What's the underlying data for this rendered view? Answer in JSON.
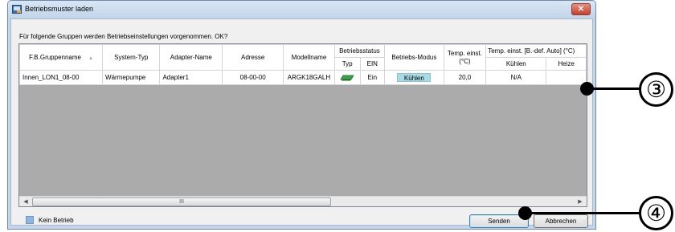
{
  "window": {
    "title": "Betriebsmuster laden",
    "close_glyph": "✕",
    "icon": "window-app-icon"
  },
  "prompt": "Für folgende Gruppen werden Betriebseinstellungen vorgenommen. OK?",
  "grid": {
    "headers": {
      "group_name": "F.B.Gruppenname",
      "system_type": "System-Typ",
      "adapter_name": "Adapter-Name",
      "address": "Adresse",
      "model_name": "Modellname",
      "operation_status": "Betriebsstatus",
      "op_type": "Typ",
      "op_on": "EIN",
      "mode": "Betriebs-Modus",
      "temp_set": "Temp. einst.",
      "temp_unit": "(°C)",
      "temp_auto": "Temp. einst. [B.-def. Auto] (°C)",
      "cooling": "Kühlen",
      "heating": "Heize"
    },
    "rows": [
      {
        "group_name": "Innen_LON1_08-00",
        "system_type": "Wärmepumpe",
        "adapter_name": "Adapter1",
        "address": "08-00-00",
        "model_name": "ARGK18GALH",
        "on": "Ein",
        "mode": "Kühlen",
        "temp_set": "20,0",
        "cooling": "N/A",
        "heating": ""
      }
    ],
    "scroll_thumb_label": "III"
  },
  "legend": {
    "label": "Kein Betrieb",
    "color": "#8fb6e0"
  },
  "buttons": {
    "send": "Senden",
    "cancel": "Abbrechen"
  },
  "callouts": {
    "three": "③",
    "four": "④"
  }
}
